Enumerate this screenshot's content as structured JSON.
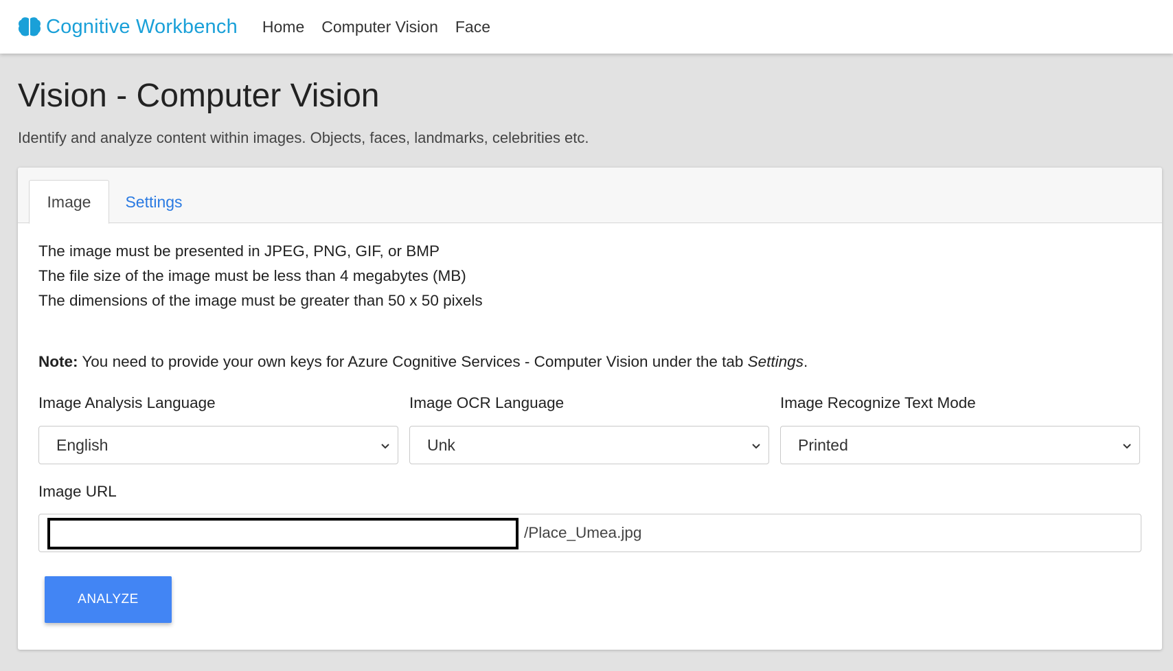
{
  "navbar": {
    "brand": "Cognitive Workbench",
    "brand_icon": "brain-icon",
    "links": [
      "Home",
      "Computer Vision",
      "Face"
    ]
  },
  "page": {
    "title": "Vision - Computer Vision",
    "subtitle": "Identify and analyze content within images. Objects, faces, landmarks, celebrities etc."
  },
  "tabs": [
    {
      "label": "Image",
      "active": true
    },
    {
      "label": "Settings",
      "active": false
    }
  ],
  "requirements": [
    "The image must be presented in JPEG, PNG, GIF, or BMP",
    "The file size of the image must be less than 4 megabytes (MB)",
    "The dimensions of the image must be greater than 50 x 50 pixels"
  ],
  "note": {
    "label": "Note:",
    "text": " You need to provide your own keys for Azure Cognitive Services - Computer Vision under the tab ",
    "tab_ref": "Settings",
    "end": "."
  },
  "fields": {
    "analysis_language": {
      "label": "Image Analysis Language",
      "value": "English"
    },
    "ocr_language": {
      "label": "Image OCR Language",
      "value": "Unk"
    },
    "text_mode": {
      "label": "Image Recognize Text Mode",
      "value": "Printed"
    },
    "image_url": {
      "label": "Image URL",
      "value": "/Place_Umea.jpg"
    }
  },
  "analyze_button": "ANALYZE",
  "colors": {
    "brand": "#1aa0d8",
    "link": "#2a7ae2",
    "button": "#4285f4",
    "background": "#e2e2e2"
  }
}
